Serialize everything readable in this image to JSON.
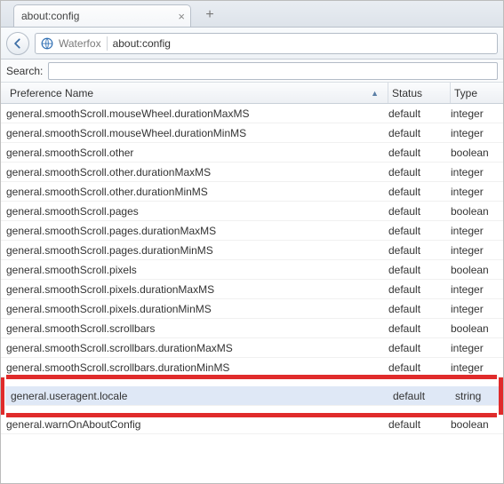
{
  "tab": {
    "title": "about:config"
  },
  "nav": {
    "brand": "Waterfox",
    "url": "about:config"
  },
  "search": {
    "label": "Search:",
    "value": ""
  },
  "columns": {
    "name": "Preference Name",
    "status": "Status",
    "type": "Type"
  },
  "rows": [
    {
      "name": "general.smoothScroll.mouseWheel.durationMaxMS",
      "status": "default",
      "type": "integer"
    },
    {
      "name": "general.smoothScroll.mouseWheel.durationMinMS",
      "status": "default",
      "type": "integer"
    },
    {
      "name": "general.smoothScroll.other",
      "status": "default",
      "type": "boolean"
    },
    {
      "name": "general.smoothScroll.other.durationMaxMS",
      "status": "default",
      "type": "integer"
    },
    {
      "name": "general.smoothScroll.other.durationMinMS",
      "status": "default",
      "type": "integer"
    },
    {
      "name": "general.smoothScroll.pages",
      "status": "default",
      "type": "boolean"
    },
    {
      "name": "general.smoothScroll.pages.durationMaxMS",
      "status": "default",
      "type": "integer"
    },
    {
      "name": "general.smoothScroll.pages.durationMinMS",
      "status": "default",
      "type": "integer"
    },
    {
      "name": "general.smoothScroll.pixels",
      "status": "default",
      "type": "boolean"
    },
    {
      "name": "general.smoothScroll.pixels.durationMaxMS",
      "status": "default",
      "type": "integer"
    },
    {
      "name": "general.smoothScroll.pixels.durationMinMS",
      "status": "default",
      "type": "integer"
    },
    {
      "name": "general.smoothScroll.scrollbars",
      "status": "default",
      "type": "boolean"
    },
    {
      "name": "general.smoothScroll.scrollbars.durationMaxMS",
      "status": "default",
      "type": "integer"
    },
    {
      "name": "general.smoothScroll.scrollbars.durationMinMS",
      "status": "default",
      "type": "integer"
    },
    {
      "name": "general.useragent.locale",
      "status": "default",
      "type": "string",
      "selected": true
    },
    {
      "name": "general.warnOnAboutConfig",
      "status": "default",
      "type": "boolean"
    }
  ]
}
